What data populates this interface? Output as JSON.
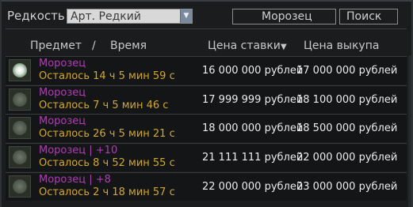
{
  "filter": {
    "rarity_label": "Редкость",
    "rarity_value": "Арт. Редкий",
    "search_value": "Морозец",
    "search_button": "Поиск"
  },
  "columns": {
    "item": "Предмет",
    "slash": "/",
    "time": "Время",
    "bid": "Цена ставки",
    "bid_sort_icon": "▼",
    "buyout": "Цена выкупа"
  },
  "rows": [
    {
      "name": "Морозец",
      "time_left": "Осталось 14 ч 5 мин 59 с",
      "bid": "16 000 000 рублей",
      "buyout": "17 000 000 рублей",
      "icon": "frost-artifact-icon"
    },
    {
      "name": "Морозец",
      "time_left": "Осталось 7 ч 5 мин 46 с",
      "bid": "17 999 999 рублей",
      "buyout": "18 100 000 рублей",
      "icon": "frost-artifact-icon"
    },
    {
      "name": "Морозец",
      "time_left": "Осталось 26 ч 5 мин 21 с",
      "bid": "18 000 000 рублей",
      "buyout": "18 500 000 рублей",
      "icon": "frost-artifact-icon"
    },
    {
      "name": "Морозец | +10",
      "time_left": "Осталось 8 ч 52 мин 55 с",
      "bid": "21 111 111 рублей",
      "buyout": "22 000 000 рублей",
      "icon": "frost-artifact-icon"
    },
    {
      "name": "Морозец | +8",
      "time_left": "Осталось 2 ч 18 мин 57 с",
      "bid": "22 000 000 рублей",
      "buyout": "23 000 000 рублей",
      "icon": "frost-artifact-icon"
    }
  ],
  "colors": {
    "item_name": "#b13db5",
    "time_left": "#d3a82a",
    "price": "#ececec"
  }
}
